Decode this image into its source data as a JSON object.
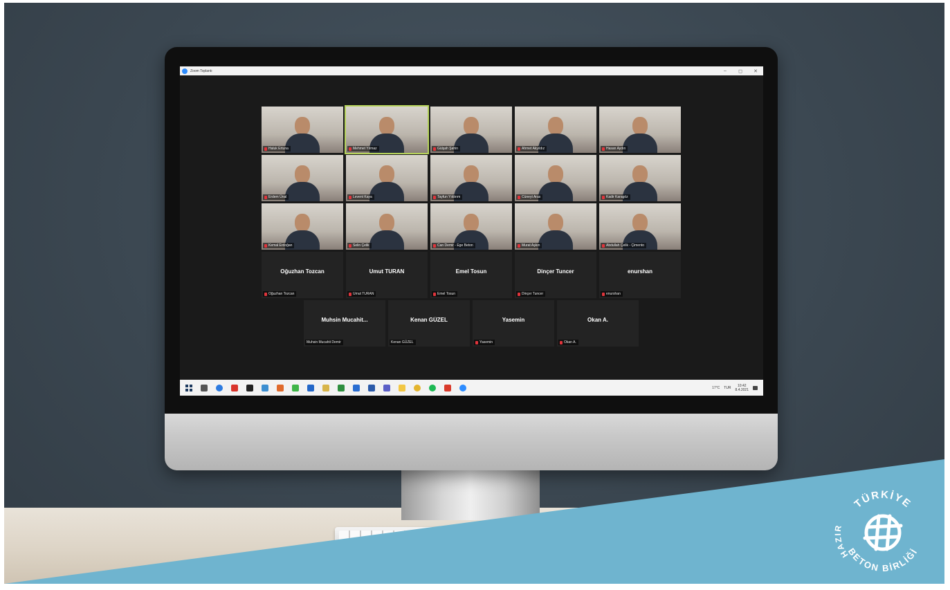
{
  "window": {
    "title": "Zoom Toplantı",
    "controls": [
      "–",
      "◻",
      "✕"
    ]
  },
  "video_tiles": [
    {
      "label": "Haluk Ertuna",
      "active": false
    },
    {
      "label": "Mehmet Yılmaz",
      "active": true
    },
    {
      "label": "Gülşah Şahin",
      "active": false
    },
    {
      "label": "Ahmet Akyıldız",
      "active": false
    },
    {
      "label": "Hasan Aydın",
      "active": false
    },
    {
      "label": "Erdem Ünal",
      "active": false
    },
    {
      "label": "Levent Kaya",
      "active": false
    },
    {
      "label": "Tayfun Yıldırım",
      "active": false
    },
    {
      "label": "Cüneyt Aras",
      "active": false
    },
    {
      "label": "Kadir Karagöz",
      "active": false
    },
    {
      "label": "Kemal Erdoğan",
      "active": false
    },
    {
      "label": "Selin Çelik",
      "active": false
    },
    {
      "label": "Can Demir - Ege Beton",
      "active": false
    },
    {
      "label": "Murat Aşkın",
      "active": false
    },
    {
      "label": "Abdullah Çelik - Çimento",
      "active": false
    }
  ],
  "name_tiles_row1": [
    {
      "name": "Oğuzhan Tozcan",
      "label": "Oğuzhan Tozcan"
    },
    {
      "name": "Umut TURAN",
      "label": "Umut TURAN"
    },
    {
      "name": "Emel Tosun",
      "label": "Emel Tosun"
    },
    {
      "name": "Dinçer Tuncer",
      "label": "Dinçer Tuncer"
    },
    {
      "name": "enurshan",
      "label": "enurshan"
    }
  ],
  "name_tiles_row2": [
    {
      "name": "Muhsin Mucahit...",
      "label": "Muhsin Mucahit Demir",
      "muted": false
    },
    {
      "name": "Kenan GÜZEL",
      "label": "Kenan GÜZEL",
      "muted": false
    },
    {
      "name": "Yasemin",
      "label": "Yasemin",
      "muted": true
    },
    {
      "name": "Okan A.",
      "label": "Okan A.",
      "muted": true
    }
  ],
  "taskbar": {
    "icons": [
      "search-icon",
      "edge-icon",
      "acrobat-icon",
      "media-icon",
      "app-icon",
      "photos-icon",
      "chat-icon",
      "calendar-icon",
      "files-icon",
      "excel-icon",
      "outlook-icon",
      "word-icon",
      "teams-icon",
      "explorer-icon",
      "chrome-icon",
      "spotify-icon",
      "pdf-icon",
      "zoom-icon"
    ],
    "icon_colors": [
      "#555555",
      "#2d7be0",
      "#d9342b",
      "#222222",
      "#3d8fd1",
      "#e06a2c",
      "#3fb548",
      "#2367c8",
      "#d8b54a",
      "#2f8f3f",
      "#2a6dd1",
      "#2b5aa9",
      "#5b5fc7",
      "#f2c744",
      "#e4b52f",
      "#1db954",
      "#d93a2b",
      "#2d8cff"
    ],
    "weather": "17°C",
    "time": "10:42",
    "date": "8.4.2021",
    "lang": "TUR"
  },
  "logo": {
    "arc_text_top": "TÜRKİYE",
    "arc_text_left": "HAZIR",
    "arc_text_bottom": "BETON BİRLİĞİ",
    "color": "#ffffff",
    "banner_color": "#6fb4cf"
  }
}
